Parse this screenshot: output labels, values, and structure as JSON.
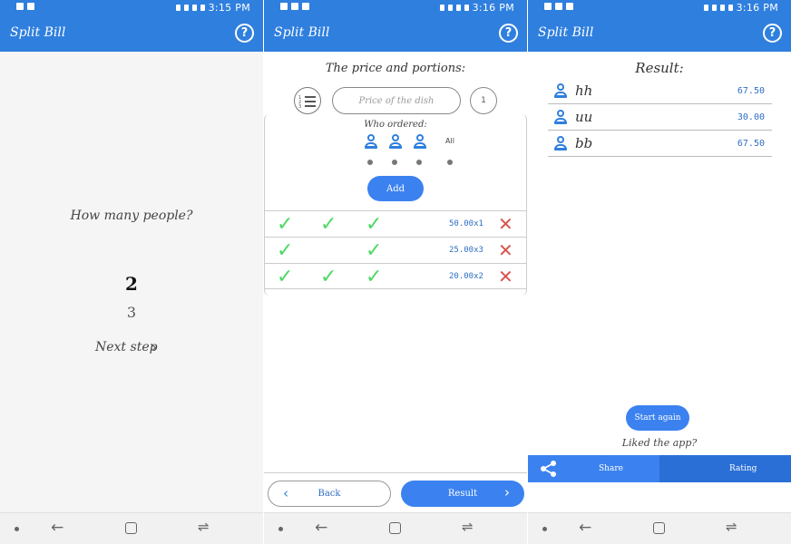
{
  "status_times": [
    "3:15 PM",
    "3:16 PM",
    "3:16 PM"
  ],
  "app_title": "Split Bill",
  "help_label": "?",
  "screen1": {
    "question": "How many people?",
    "selected_count": "2",
    "next_count": "3",
    "next_step": "Next step"
  },
  "screen2": {
    "heading": "The price and portions:",
    "price_placeholder": "Price of the dish",
    "quantity": "1",
    "who_ordered": "Who ordered:",
    "all_label": "All",
    "add_label": "Add",
    "orders": [
      {
        "checks": [
          true,
          true,
          true
        ],
        "price": "50.00x1"
      },
      {
        "checks": [
          true,
          false,
          true
        ],
        "price": "25.00x3"
      },
      {
        "checks": [
          true,
          true,
          true
        ],
        "price": "20.00x2"
      }
    ],
    "back_label": "Back",
    "result_label": "Result"
  },
  "screen3": {
    "heading": "Result:",
    "results": [
      {
        "name": "hh",
        "amount": "67.50"
      },
      {
        "name": "uu",
        "amount": "30.00"
      },
      {
        "name": "bb",
        "amount": "67.50"
      }
    ],
    "start_again": "Start again",
    "liked": "Liked the app?",
    "share": "Share",
    "rating": "Rating"
  },
  "colors": {
    "primary": "#2f7fde",
    "button": "#3b82f0",
    "check": "#4cd964",
    "delete": "#d9534f",
    "amount": "#2e6fc4"
  }
}
